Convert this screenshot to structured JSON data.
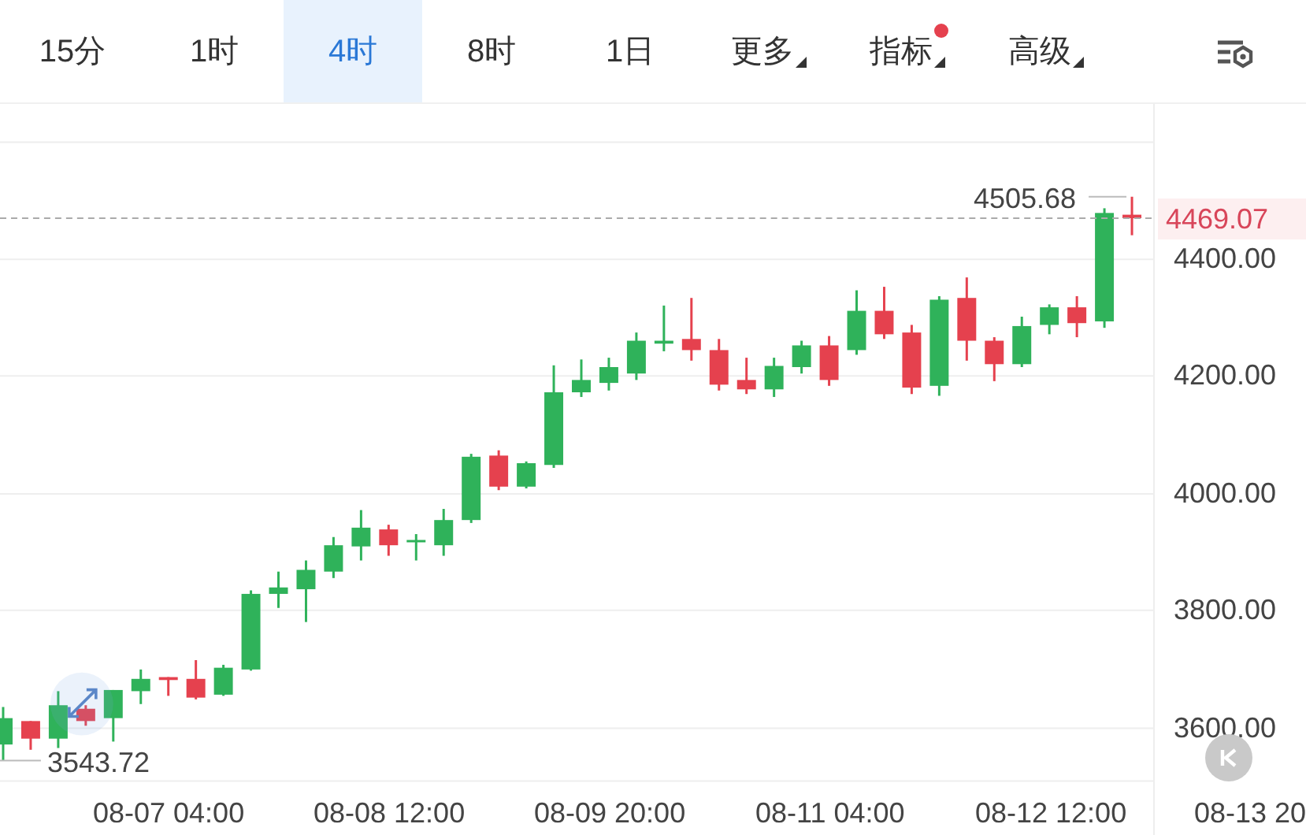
{
  "tabs": [
    {
      "label": "15分",
      "kind": "period",
      "selected": false
    },
    {
      "label": "1时",
      "kind": "period",
      "selected": false
    },
    {
      "label": "4时",
      "kind": "period",
      "selected": true
    },
    {
      "label": "8时",
      "kind": "period",
      "selected": false
    },
    {
      "label": "1日",
      "kind": "period",
      "selected": false
    },
    {
      "label": "更多",
      "kind": "menu",
      "selected": false,
      "badge": false
    },
    {
      "label": "指标",
      "kind": "menu",
      "selected": false,
      "badge": true
    },
    {
      "label": "高级",
      "kind": "menu",
      "selected": false,
      "badge": false
    }
  ],
  "chart": {
    "chart_data": {
      "type": "candlestick",
      "categories": [
        null,
        null,
        null,
        null,
        null,
        null,
        "08-07 04:00",
        null,
        null,
        null,
        null,
        null,
        null,
        null,
        "08-08 12:00",
        null,
        null,
        null,
        null,
        null,
        null,
        null,
        "08-09 20:00",
        null,
        null,
        null,
        null,
        null,
        null,
        null,
        "08-11 04:00",
        null,
        null,
        null,
        null,
        null,
        null,
        null,
        "08-12 12:00",
        null,
        null,
        null,
        null,
        null,
        null,
        null,
        "08-13 20"
      ],
      "ohlc": [
        [
          3571,
          3635,
          3543.72,
          3616
        ],
        [
          3611,
          3611,
          3562,
          3581
        ],
        [
          3581,
          3662,
          3565,
          3638
        ],
        [
          3632,
          3638,
          3603,
          3611
        ],
        [
          3616,
          3664,
          3576,
          3664
        ],
        [
          3662,
          3699,
          3640,
          3683
        ],
        [
          3686,
          3686,
          3654,
          3681
        ],
        [
          3683,
          3715,
          3648,
          3651
        ],
        [
          3656,
          3707,
          3654,
          3702
        ],
        [
          3699,
          3834,
          3697,
          3828
        ],
        [
          3828,
          3866,
          3804,
          3839
        ],
        [
          3836,
          3885,
          3780,
          3869
        ],
        [
          3866,
          3925,
          3855,
          3911
        ],
        [
          3909,
          3971,
          3885,
          3941
        ],
        [
          3938,
          3946,
          3893,
          3911
        ],
        [
          3917,
          3930,
          3885,
          3920
        ],
        [
          3911,
          3973,
          3893,
          3954
        ],
        [
          3954,
          4067,
          3949,
          4062
        ],
        [
          4064,
          4073,
          4005,
          4011
        ],
        [
          4011,
          4054,
          4008,
          4051
        ],
        [
          4048,
          4218,
          4043,
          4172
        ],
        [
          4172,
          4228,
          4164,
          4193
        ],
        [
          4188,
          4231,
          4175,
          4215
        ],
        [
          4204,
          4274,
          4193,
          4260
        ],
        [
          4255,
          4320,
          4242,
          4260
        ],
        [
          4263,
          4333,
          4226,
          4244
        ],
        [
          4244,
          4263,
          4175,
          4185
        ],
        [
          4193,
          4231,
          4169,
          4177
        ],
        [
          4177,
          4231,
          4164,
          4217
        ],
        [
          4215,
          4260,
          4204,
          4252
        ],
        [
          4252,
          4268,
          4183,
          4193
        ],
        [
          4244,
          4346,
          4236,
          4311
        ],
        [
          4311,
          4352,
          4263,
          4271
        ],
        [
          4274,
          4287,
          4169,
          4180
        ],
        [
          4183,
          4336,
          4166,
          4330
        ],
        [
          4333,
          4368,
          4226,
          4260
        ],
        [
          4260,
          4266,
          4191,
          4220
        ],
        [
          4220,
          4301,
          4215,
          4285
        ],
        [
          4287,
          4322,
          4271,
          4317
        ],
        [
          4317,
          4336,
          4266,
          4290
        ],
        [
          4293,
          4486,
          4282,
          4478
        ],
        [
          4475,
          4505.68,
          4440,
          4469.07
        ],
        null,
        null,
        null,
        null,
        null
      ],
      "ylim": [
        3508.7,
        4663.1
      ],
      "grid": true,
      "ref_lines": [
        {
          "axis": "y",
          "value": 4469.07
        }
      ],
      "yticks": [
        {
          "value": 4400,
          "label": "4400.00"
        },
        {
          "value": 4200,
          "label": "4200.00"
        },
        {
          "value": 4000,
          "label": "4000.00"
        },
        {
          "value": 3800,
          "label": "3800.00"
        },
        {
          "value": 3600,
          "label": "3600.00"
        }
      ]
    },
    "high_label": "4505.68",
    "low_label": "3543.72",
    "last_price": "4469.07"
  }
}
